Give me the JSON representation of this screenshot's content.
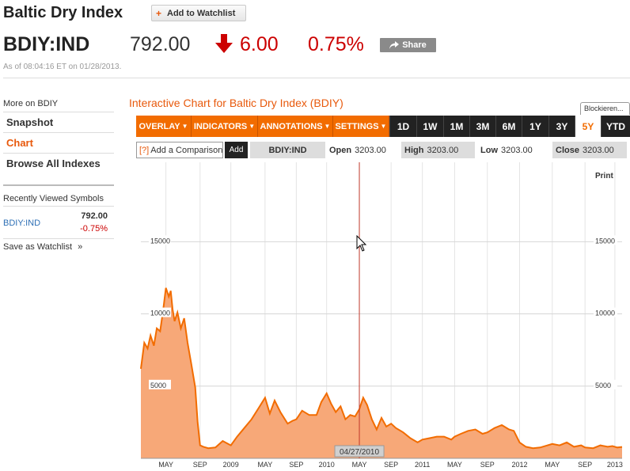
{
  "header": {
    "title": "Baltic Dry Index",
    "watchlist_label": "Add to Watchlist",
    "symbol": "BDIY:IND",
    "price": "792.00",
    "change": "6.00",
    "change_pct": "0.75%",
    "share_label": "Share",
    "as_of": "As of 08:04:16 ET on 01/28/2013."
  },
  "sidebar": {
    "more_on": "More on BDIY",
    "items": [
      {
        "label": "Snapshot"
      },
      {
        "label": "Chart"
      },
      {
        "label": "Browse All Indexes"
      }
    ],
    "recent_heading": "Recently Viewed Symbols",
    "recent": {
      "symbol": "BDIY:IND",
      "price": "792.00",
      "change": "-0.75%"
    },
    "save_watchlist": "Save as Watchlist"
  },
  "chart": {
    "title": "Interactive Chart for Baltic Dry Index (BDIY)",
    "blockieren": "Blockieren...",
    "menus": [
      "OVERLAY",
      "INDICATORS",
      "ANNOTATIONS",
      "SETTINGS"
    ],
    "ranges": [
      "1D",
      "1W",
      "1M",
      "3M",
      "6M",
      "1Y",
      "3Y",
      "5Y",
      "YTD"
    ],
    "active_range": "5Y",
    "compare_placeholder": "Add a Comparison",
    "compare_help": "[?]",
    "add_label": "Add",
    "symbol_label": "BDIY:IND",
    "open_label": "Open",
    "open_value": "3203.00",
    "high_label": "High",
    "high_value": "3203.00",
    "low_label": "Low",
    "low_value": "3203.00",
    "close_label": "Close",
    "close_value": "3203.00",
    "print_label": "Print",
    "crosshair_date": "04/27/2010"
  },
  "chart_data": {
    "type": "area",
    "title": "Interactive Chart for Baltic Dry Index (BDIY)",
    "y_ticks": [
      5000,
      10000,
      15000
    ],
    "ylim": [
      0,
      20500
    ],
    "x_tick_labels": [
      "MAY",
      "SEP",
      "2009",
      "MAY",
      "SEP",
      "2010",
      "MAY",
      "SEP",
      "2011",
      "MAY",
      "SEP",
      "2012",
      "MAY",
      "SEP",
      "2013"
    ],
    "x_tick_fracs": [
      0.052,
      0.123,
      0.187,
      0.258,
      0.323,
      0.386,
      0.454,
      0.52,
      0.585,
      0.652,
      0.72,
      0.787,
      0.855,
      0.923,
      0.985
    ],
    "series": [
      {
        "color": "#f26c00",
        "fill": "#f7a878",
        "t": [
          0.0,
          0.007,
          0.014,
          0.02,
          0.027,
          0.033,
          0.04,
          0.046,
          0.052,
          0.058,
          0.062,
          0.066,
          0.07,
          0.076,
          0.083,
          0.09,
          0.097,
          0.105,
          0.113,
          0.118,
          0.123,
          0.13,
          0.14,
          0.155,
          0.17,
          0.187,
          0.2,
          0.215,
          0.23,
          0.245,
          0.258,
          0.268,
          0.278,
          0.29,
          0.305,
          0.315,
          0.323,
          0.335,
          0.35,
          0.365,
          0.375,
          0.386,
          0.395,
          0.405,
          0.415,
          0.425,
          0.435,
          0.445,
          0.454,
          0.462,
          0.47,
          0.48,
          0.49,
          0.5,
          0.51,
          0.52,
          0.53,
          0.545,
          0.56,
          0.575,
          0.585,
          0.6,
          0.615,
          0.63,
          0.645,
          0.652,
          0.665,
          0.68,
          0.695,
          0.71,
          0.72,
          0.735,
          0.75,
          0.765,
          0.775,
          0.787,
          0.8,
          0.815,
          0.83,
          0.845,
          0.855,
          0.87,
          0.885,
          0.9,
          0.915,
          0.923,
          0.94,
          0.955,
          0.97,
          0.98,
          0.99,
          1.0
        ],
        "values": [
          6200,
          8000,
          7600,
          8500,
          7800,
          9000,
          8800,
          10200,
          11800,
          11200,
          11600,
          10300,
          9500,
          10100,
          9000,
          9700,
          8000,
          6500,
          4900,
          2500,
          900,
          800,
          700,
          750,
          1200,
          900,
          1500,
          2100,
          2700,
          3500,
          4200,
          3100,
          4000,
          3200,
          2400,
          2600,
          2700,
          3300,
          3000,
          3000,
          3900,
          4500,
          3800,
          3200,
          3600,
          2700,
          3000,
          2900,
          3400,
          4200,
          3700,
          2700,
          2000,
          2800,
          2200,
          2400,
          2100,
          1800,
          1400,
          1100,
          1300,
          1400,
          1500,
          1500,
          1300,
          1500,
          1700,
          1900,
          2000,
          1700,
          1800,
          2100,
          2300,
          2000,
          1900,
          1100,
          800,
          700,
          750,
          900,
          1000,
          900,
          1100,
          800,
          900,
          750,
          700,
          900,
          800,
          850,
          750,
          792
        ]
      }
    ],
    "crosshair_frac": 0.454,
    "grid": true
  }
}
